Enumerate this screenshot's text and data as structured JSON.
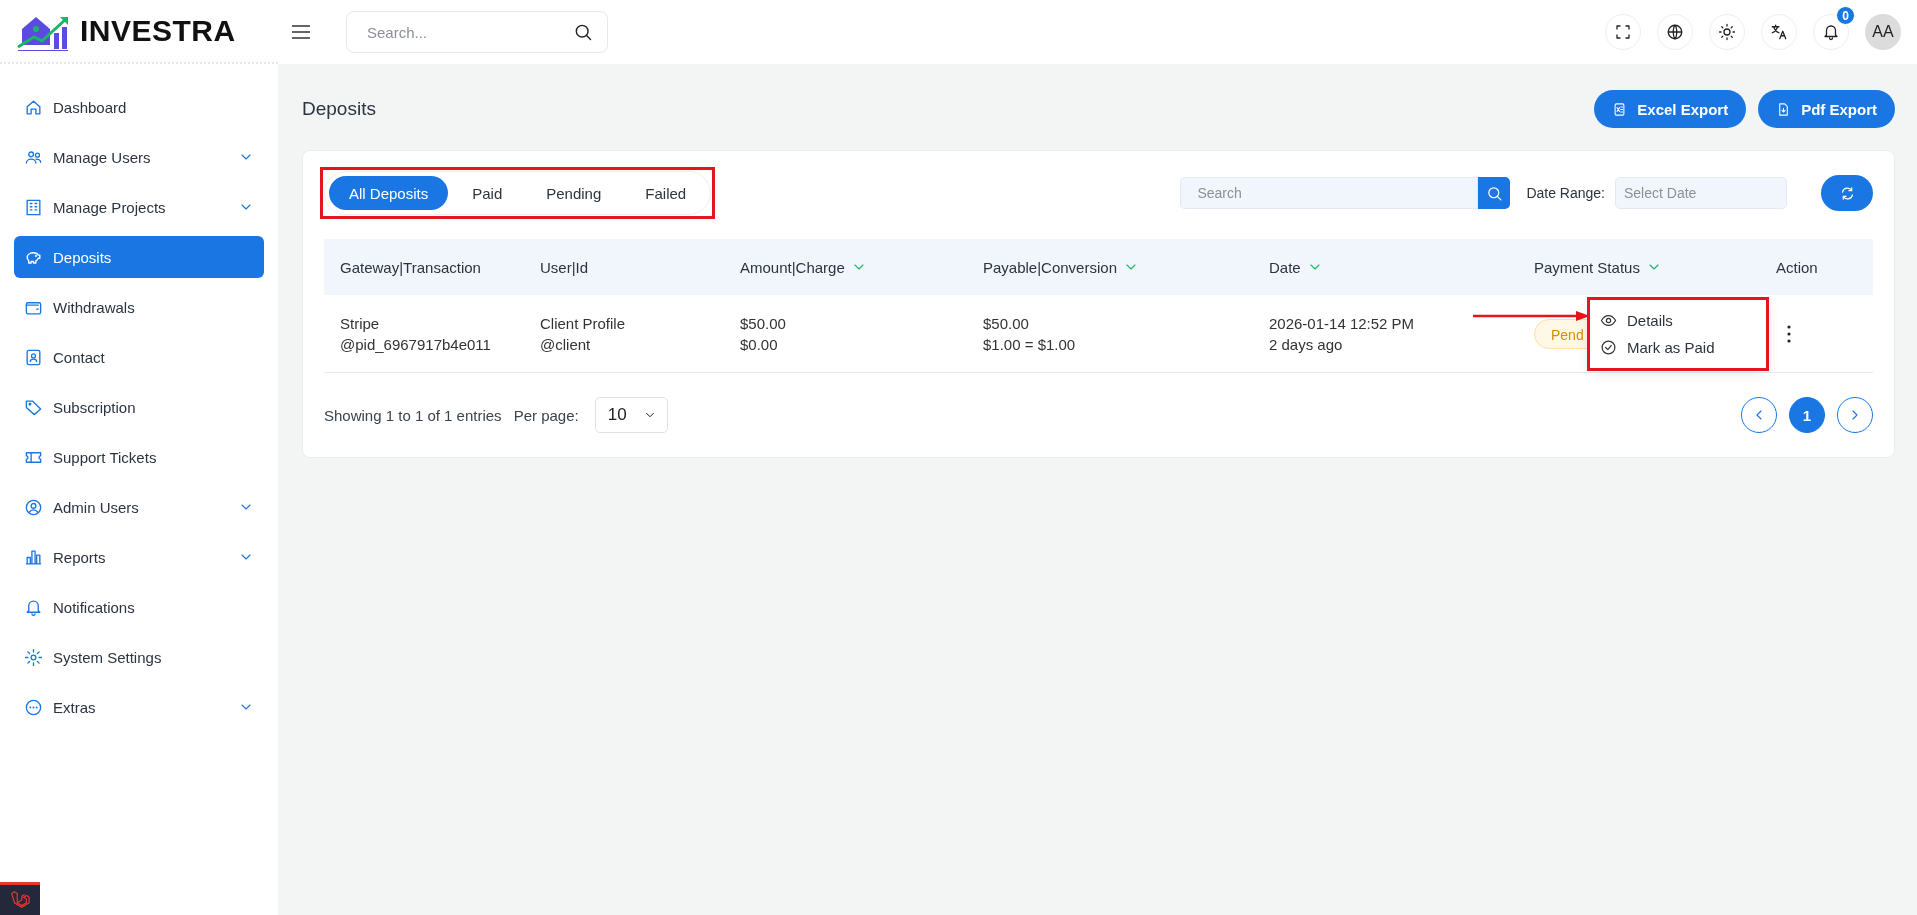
{
  "logo": {
    "text": "INVESTRA"
  },
  "header": {
    "search_placeholder": "Search...",
    "notification_count": "0",
    "avatar": "AA"
  },
  "sidebar": {
    "items": [
      {
        "label": "Dashboard",
        "selected": false,
        "expandable": false
      },
      {
        "label": "Manage Users",
        "selected": false,
        "expandable": true
      },
      {
        "label": "Manage Projects",
        "selected": false,
        "expandable": true
      },
      {
        "label": "Deposits",
        "selected": true,
        "expandable": false
      },
      {
        "label": "Withdrawals",
        "selected": false,
        "expandable": false
      },
      {
        "label": "Contact",
        "selected": false,
        "expandable": false
      },
      {
        "label": "Subscription",
        "selected": false,
        "expandable": false
      },
      {
        "label": "Support Tickets",
        "selected": false,
        "expandable": false
      },
      {
        "label": "Admin Users",
        "selected": false,
        "expandable": true
      },
      {
        "label": "Reports",
        "selected": false,
        "expandable": true
      },
      {
        "label": "Notifications",
        "selected": false,
        "expandable": false
      },
      {
        "label": "System Settings",
        "selected": false,
        "expandable": false
      },
      {
        "label": "Extras",
        "selected": false,
        "expandable": true
      }
    ]
  },
  "page": {
    "title": "Deposits",
    "actions": [
      "Excel Export",
      "Pdf Export"
    ]
  },
  "filters": {
    "tabs": [
      {
        "label": "All Deposits",
        "selected": true
      },
      {
        "label": "Paid",
        "selected": false
      },
      {
        "label": "Pending",
        "selected": false
      },
      {
        "label": "Failed",
        "selected": false
      }
    ],
    "search_placeholder": "Search",
    "date_label": "Date Range:",
    "date_placeholder": "Select Date"
  },
  "table": {
    "columns": [
      {
        "label": "Gateway|Transaction",
        "sortable": false
      },
      {
        "label": "User|Id",
        "sortable": false
      },
      {
        "label": "Amount|Charge",
        "sortable": true
      },
      {
        "label": "Payable|Conversion",
        "sortable": true
      },
      {
        "label": "Date",
        "sortable": true
      },
      {
        "label": "Payment Status",
        "sortable": true
      },
      {
        "label": "Action",
        "sortable": false
      }
    ],
    "rows": [
      {
        "gateway": "Stripe",
        "transaction": "@pid_6967917b4e011",
        "user": "Client Profile",
        "user_id": "@client",
        "amount": "$50.00",
        "charge": "$0.00",
        "payable": "$50.00",
        "conversion": "$1.00 = $1.00",
        "date": "2026-01-14 12:52 PM",
        "ago": "2 days ago",
        "status": {
          "text": "Pend",
          "kind": "pending"
        }
      }
    ]
  },
  "row_menu": {
    "items": [
      {
        "label": "Details"
      },
      {
        "label": "Mark as Paid"
      }
    ]
  },
  "footer": {
    "summary": "Showing 1 to 1 of 1 entries",
    "per_page_label": "Per page:",
    "per_page": "10",
    "pages": [
      {
        "label": "1",
        "selected": true
      }
    ]
  }
}
